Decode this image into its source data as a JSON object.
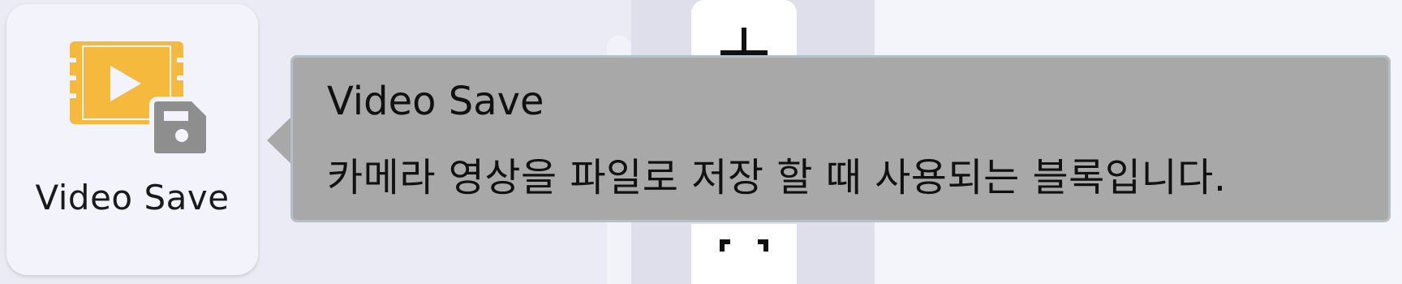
{
  "block": {
    "label": "Video Save",
    "icon": "video-save-icon",
    "icon_color": "#f5b93e",
    "badge_color": "#8e8e8e"
  },
  "tooltip": {
    "title": "Video Save",
    "description": "카메라 영상을 파일로 저장 할 때 사용되는 블록입니다."
  },
  "colors": {
    "background": "#ebebf5",
    "tooltip_bg": "#a8a8a8",
    "tooltip_border": "#b6bec6"
  },
  "toolbar": {
    "top_icon": "add-icon",
    "bottom_icon": "crop-frame-icon"
  }
}
